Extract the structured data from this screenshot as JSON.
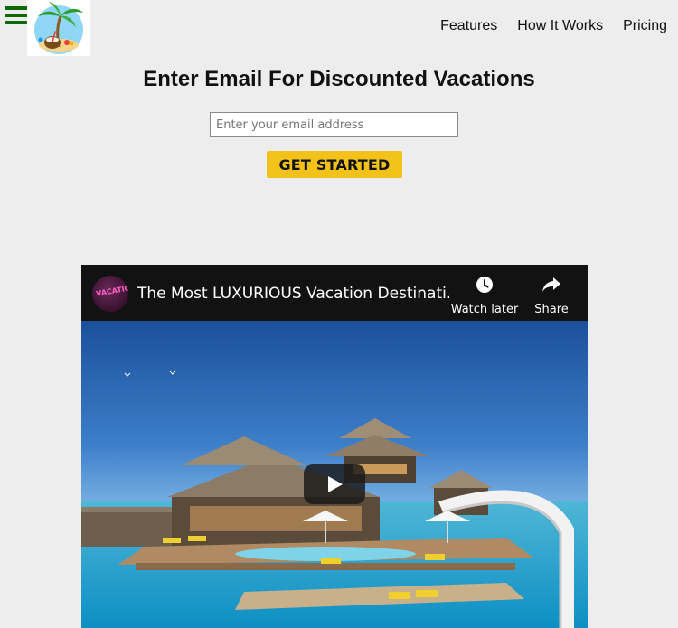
{
  "header": {
    "nav": [
      "Features",
      "How It Works",
      "Pricing"
    ]
  },
  "hero": {
    "headline": "Enter Email For Discounted Vacations",
    "email_placeholder": "Enter your email address",
    "cta_label": "GET STARTED"
  },
  "video": {
    "title": "The Most LUXURIOUS Vacation Destinati...",
    "channel_avatar_text": "VACATION",
    "watch_later_label": "Watch later",
    "share_label": "Share"
  },
  "colors": {
    "background": "#ededed",
    "cta": "#f2c21b",
    "hamburger": "#0b6b0b"
  }
}
